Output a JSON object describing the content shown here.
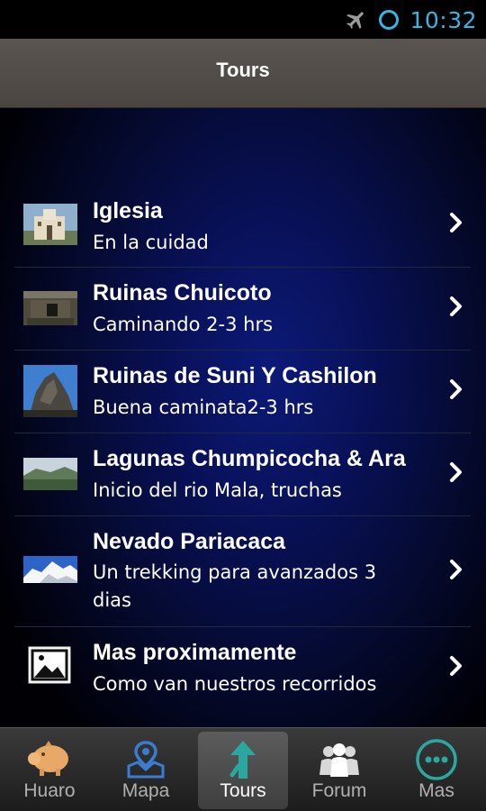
{
  "status_bar": {
    "time": "10:32",
    "icons": [
      "airplane-mode-icon",
      "sync-circle-icon"
    ]
  },
  "header": {
    "title": "Tours"
  },
  "tours": [
    {
      "title": "Iglesia",
      "subtitle": "En la cuidad",
      "thumb": "church-photo"
    },
    {
      "title": "Ruinas Chuicoto",
      "subtitle": "Caminando 2-3 hrs",
      "thumb": "ruins-photo"
    },
    {
      "title": "Ruinas de Suni Y Cashilon",
      "subtitle": "Buena caminata2-3 hrs",
      "thumb": "rock-sky-photo"
    },
    {
      "title": "Lagunas Chumpicocha & Ara",
      "subtitle": "Inicio del rio Mala, truchas",
      "thumb": "lagoon-photo"
    },
    {
      "title": "Nevado Pariacaca",
      "subtitle": "Un trekking para avanzados 3 dias",
      "thumb": "snow-mountain-photo"
    },
    {
      "title": "Mas proximamente",
      "subtitle": "Como van nuestros recorridos",
      "thumb": "image-placeholder-icon"
    }
  ],
  "bottom_nav": {
    "active": "Tours",
    "tabs": [
      {
        "label": "Huaro",
        "icon": "piggy-icon"
      },
      {
        "label": "Mapa",
        "icon": "map-icon"
      },
      {
        "label": "Tours",
        "icon": "walker-arrow-icon"
      },
      {
        "label": "Forum",
        "icon": "people-icon"
      },
      {
        "label": "Mas",
        "icon": "more-dots-icon"
      }
    ]
  },
  "colors": {
    "accent": "#33b5e5",
    "tab_teal": "#2aa8a0",
    "background_glow": "#0c1a78"
  }
}
